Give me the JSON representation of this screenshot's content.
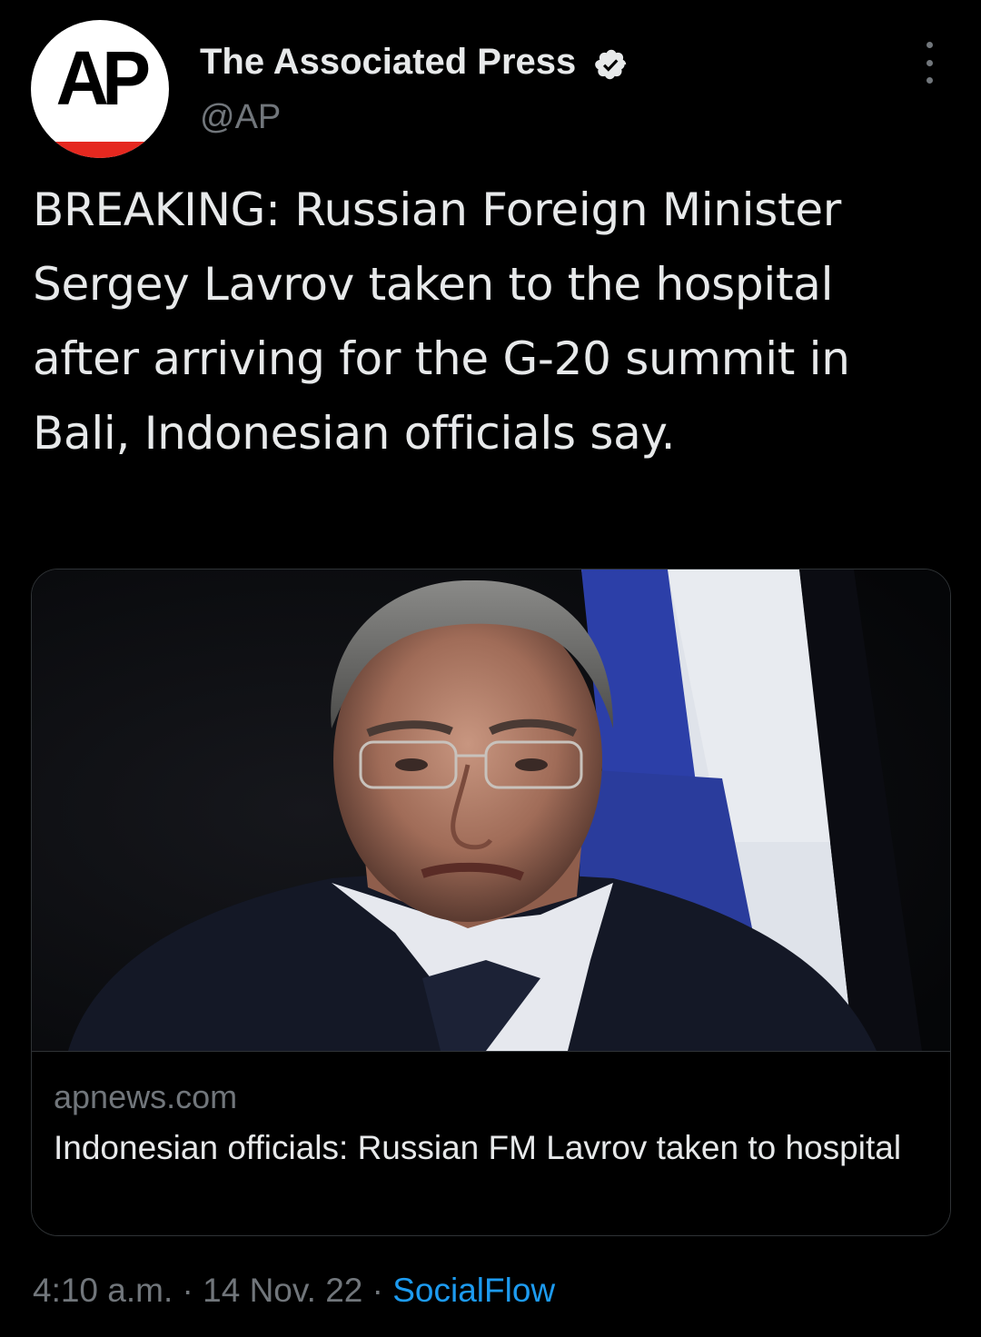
{
  "account": {
    "display_name": "The Associated Press",
    "handle": "@AP",
    "avatar_text": "AP",
    "verified": true
  },
  "tweet": {
    "text": "BREAKING: Russian Foreign Minister Sergey Lavrov taken to the hospital after arriving for the G-20 summit in Bali, Indonesian officials say."
  },
  "card": {
    "domain": "apnews.com",
    "title": "Indonesian officials: Russian FM Lavrov taken to hospital"
  },
  "footer": {
    "time": "4:10 a.m.",
    "separator": "·",
    "date": "14 Nov. 22",
    "source": "SocialFlow"
  },
  "icons": {
    "verified": "verified-badge-icon",
    "more": "more-options-icon"
  },
  "colors": {
    "background": "#000000",
    "text": "#e7e9ea",
    "muted": "#71767b",
    "link": "#1d9bf0",
    "border": "#2f3336",
    "ap_red": "#e5281f"
  }
}
